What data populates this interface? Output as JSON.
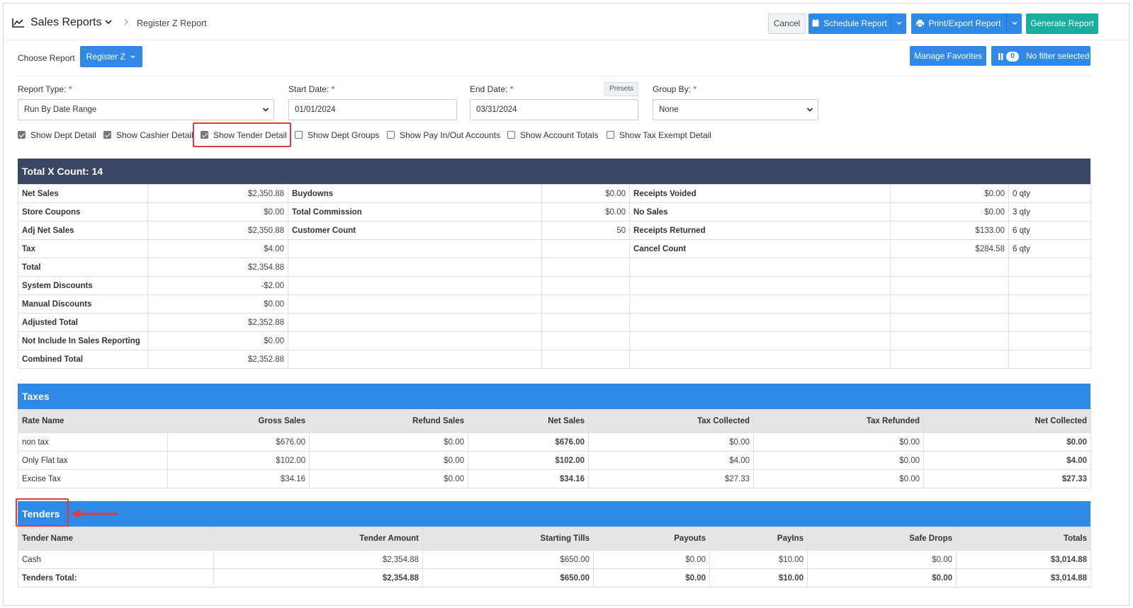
{
  "header": {
    "title": "Sales Reports",
    "breadcrumb": "Register Z Report",
    "cancel_label": "Cancel",
    "schedule_label": "Schedule Report",
    "print_label": "Print/Export Report",
    "generate_label": "Generate Report"
  },
  "choose": {
    "label": "Choose Report",
    "selected": "Register Z",
    "favorites_label": "Manage Favorites",
    "filter_count": "0",
    "filter_label": "No filter selected"
  },
  "form": {
    "report_type_label": "Report Type:",
    "report_type_value": "Run By Date Range",
    "start_date_label": "Start Date:",
    "start_date_value": "01/01/2024",
    "end_date_label": "End Date:",
    "end_date_value": "03/31/2024",
    "presets_label": "Presets",
    "group_by_label": "Group By:",
    "group_by_value": "None",
    "required_mark": "*"
  },
  "options": [
    {
      "label": "Show Dept Detail",
      "checked": true
    },
    {
      "label": "Show Cashier Detail",
      "checked": true
    },
    {
      "label": "Show Tender Detail",
      "checked": true
    },
    {
      "label": "Show Dept Groups",
      "checked": false
    },
    {
      "label": "Show Pay In/Out Accounts",
      "checked": false
    },
    {
      "label": "Show Account Totals",
      "checked": false
    },
    {
      "label": "Show Tax Exempt Detail",
      "checked": false
    }
  ],
  "summary": {
    "title": "Total X Count: 14",
    "rows": [
      [
        "Net Sales",
        "$2,350.88",
        "Buydowns",
        "$0.00",
        "Receipts Voided",
        "$0.00",
        "0 qty"
      ],
      [
        "Store Coupons",
        "$0.00",
        "Total Commission",
        "$0.00",
        "No Sales",
        "$0.00",
        "3 qty"
      ],
      [
        "Adj Net Sales",
        "$2,350.88",
        "Customer Count",
        "50",
        "Receipts Returned",
        "$133.00",
        "6 qty"
      ],
      [
        "Tax",
        "$4.00",
        "",
        "",
        "Cancel Count",
        "$284.58",
        "6 qty"
      ],
      [
        "Total",
        "$2,354.88",
        "",
        "",
        "",
        "",
        ""
      ],
      [
        "System Discounts",
        "-$2.00",
        "",
        "",
        "",
        "",
        ""
      ],
      [
        "Manual Discounts",
        "$0.00",
        "",
        "",
        "",
        "",
        ""
      ],
      [
        "Adjusted Total",
        "$2,352.88",
        "",
        "",
        "",
        "",
        ""
      ],
      [
        "Not Include In Sales Reporting",
        "$0.00",
        "",
        "",
        "",
        "",
        ""
      ],
      [
        "Combined Total",
        "$2,352.88",
        "",
        "",
        "",
        "",
        ""
      ]
    ]
  },
  "taxes": {
    "title": "Taxes",
    "columns": [
      "Rate Name",
      "Gross Sales",
      "Refund Sales",
      "Net Sales",
      "Tax Collected",
      "Tax Refunded",
      "Net Collected"
    ],
    "rows": [
      [
        "non tax",
        "$676.00",
        "$0.00",
        "$676.00",
        "$0.00",
        "$0.00",
        "$0.00"
      ],
      [
        "Only Flat tax",
        "$102.00",
        "$0.00",
        "$102.00",
        "$4.00",
        "$0.00",
        "$4.00"
      ],
      [
        "Excise Tax",
        "$34.16",
        "$0.00",
        "$34.16",
        "$27.33",
        "$0.00",
        "$27.33"
      ]
    ]
  },
  "tenders": {
    "title": "Tenders",
    "columns": [
      "Tender Name",
      "Tender Amount",
      "Starting Tills",
      "Payouts",
      "PayIns",
      "Safe Drops",
      "Totals"
    ],
    "rows": [
      [
        "Cash",
        "$2,354.88",
        "$650.00",
        "$0.00",
        "$10.00",
        "$0.00",
        "$3,014.88"
      ]
    ],
    "total_row": [
      "Tenders Total:",
      "$2,354.88",
      "$650.00",
      "$0.00",
      "$10.00",
      "$0.00",
      "$3,014.88"
    ]
  },
  "colors": {
    "primary": "#2e8ae6",
    "teal": "#1aae9f",
    "navy": "#3a4663",
    "highlight": "#e03c3c"
  }
}
